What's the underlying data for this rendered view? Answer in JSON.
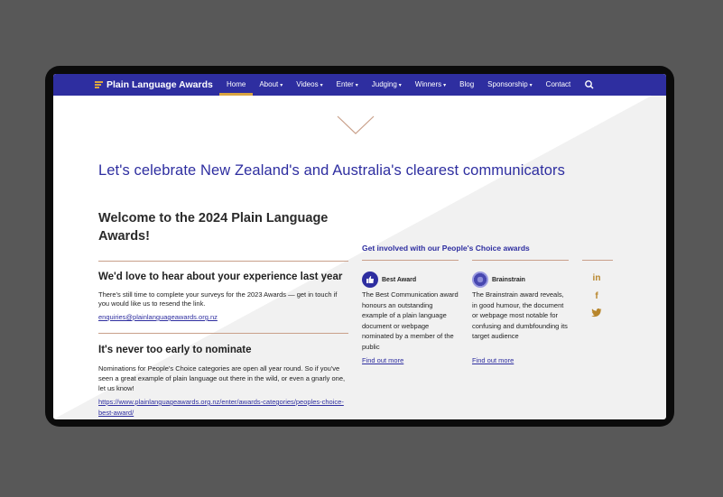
{
  "nav": {
    "logo_text": "Plain Language Awards",
    "items": [
      {
        "label": "Home",
        "caret": ""
      },
      {
        "label": "About",
        "caret": "▾"
      },
      {
        "label": "Videos",
        "caret": "▾"
      },
      {
        "label": "Enter",
        "caret": "▾"
      },
      {
        "label": "Judging",
        "caret": "▾"
      },
      {
        "label": "Winners",
        "caret": "▾"
      },
      {
        "label": "Blog",
        "caret": ""
      },
      {
        "label": "Sponsorship",
        "caret": "▾"
      },
      {
        "label": "Contact",
        "caret": ""
      }
    ],
    "active": "Home",
    "search_icon": "search-icon"
  },
  "hero": {
    "headline": "Let's celebrate New Zealand's and Australia's clearest communicators",
    "chevron_icon": "chevron-down-icon"
  },
  "main": {
    "welcome": "Welcome to the 2024 Plain Language Awards!",
    "section1": {
      "heading": "We'd love to hear about your experience last year",
      "body": "There's still time to complete your surveys for the 2023 Awards — get in touch if you would like us to resend the link.",
      "link": "enquiries@plainlanguageawards.org.nz"
    },
    "section2": {
      "heading": "It's never too early to nominate",
      "body": "Nominations for People's Choice categories are open all year round. So if you've seen a great example of plain language out there in the wild, or even a gnarly one, let us know!",
      "link": "https://www.plainlanguageawards.org.nz/enter/awards-categories/peoples-choice-best-award/"
    }
  },
  "peoples_choice": {
    "heading": "Get involved with our People's Choice awards",
    "cards": [
      {
        "title": "Best Award",
        "icon": "thumbs-up-icon",
        "text": "The Best Communication award honours an outstanding example of a plain language document or webpage nominated by a member of the public",
        "link": "Find out more"
      },
      {
        "title": "Brainstrain",
        "icon": "brainstrain-icon",
        "text": "The Brainstrain award reveals, in good humour, the document or webpage most notable for confusing and dumbfounding its target audience",
        "link": "Find out more"
      }
    ]
  },
  "social": {
    "linkedin": "in",
    "facebook": "f",
    "twitter_icon": "twitter-icon"
  },
  "colors": {
    "brand": "#2e2ea0",
    "accent": "#d9a441",
    "social": "#b8862b"
  }
}
